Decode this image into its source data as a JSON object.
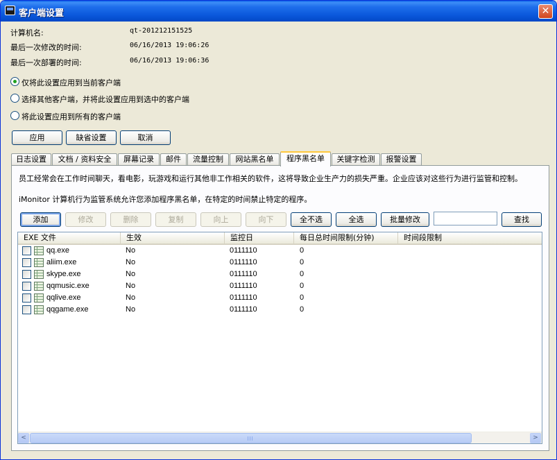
{
  "window": {
    "title": "客户端设置",
    "close_label": "✕"
  },
  "info": [
    {
      "label": "计算机名:",
      "value": "qt-201212151525"
    },
    {
      "label": "最后一次修改的时间:",
      "value": "06/16/2013 19:06:26"
    },
    {
      "label": "最后一次部署的时间:",
      "value": "06/16/2013 19:06:36"
    }
  ],
  "apply_options": [
    {
      "label": "仅将此设置应用到当前客户端",
      "checked": true
    },
    {
      "label": "选择其他客户端，并将此设置应用到选中的客户端",
      "checked": false
    },
    {
      "label": "将此设置应用到所有的客户端",
      "checked": false
    }
  ],
  "actions": {
    "apply": "应用",
    "default": "缺省设置",
    "cancel": "取消"
  },
  "tabs": [
    {
      "label": "日志设置"
    },
    {
      "label": "文档 / 资料安全"
    },
    {
      "label": "屏幕记录"
    },
    {
      "label": "邮件"
    },
    {
      "label": "流量控制"
    },
    {
      "label": "网站黑名单"
    },
    {
      "label": "程序黑名单",
      "selected": true
    },
    {
      "label": "关键字检测"
    },
    {
      "label": "报警设置"
    }
  ],
  "panel": {
    "desc1": "员工经常会在工作时间聊天，看电影，玩游戏和运行其他非工作相关的软件，这将导致企业生产力的损失严重。企业应该对这些行为进行监管和控制。",
    "desc2": "iMonitor 计算机行为监管系统允许您添加程序黑名单，在特定的时间禁止特定的程序。",
    "toolbar": {
      "add": "添加",
      "edit": "修改",
      "delete": "删除",
      "copy": "复制",
      "up": "向上",
      "down": "向下",
      "select_none": "全不选",
      "select_all": "全选",
      "batch_edit": "批量修改",
      "search_value": "",
      "find": "查找"
    },
    "columns": {
      "exe": "EXE 文件",
      "enabled": "生效",
      "days": "监控日",
      "daily_limit": "每日总时间限制(分钟)",
      "time_range": "时间段限制"
    },
    "rows": [
      {
        "exe": "qq.exe",
        "enabled": "No",
        "days": "0111110",
        "limit": "0"
      },
      {
        "exe": "aliim.exe",
        "enabled": "No",
        "days": "0111110",
        "limit": "0"
      },
      {
        "exe": "skype.exe",
        "enabled": "No",
        "days": "0111110",
        "limit": "0"
      },
      {
        "exe": "qqmusic.exe",
        "enabled": "No",
        "days": "0111110",
        "limit": "0"
      },
      {
        "exe": "qqlive.exe",
        "enabled": "No",
        "days": "0111110",
        "limit": "0"
      },
      {
        "exe": "qqgame.exe",
        "enabled": "No",
        "days": "0111110",
        "limit": "0"
      }
    ],
    "scroll": {
      "left": "<",
      "right": ">"
    }
  }
}
